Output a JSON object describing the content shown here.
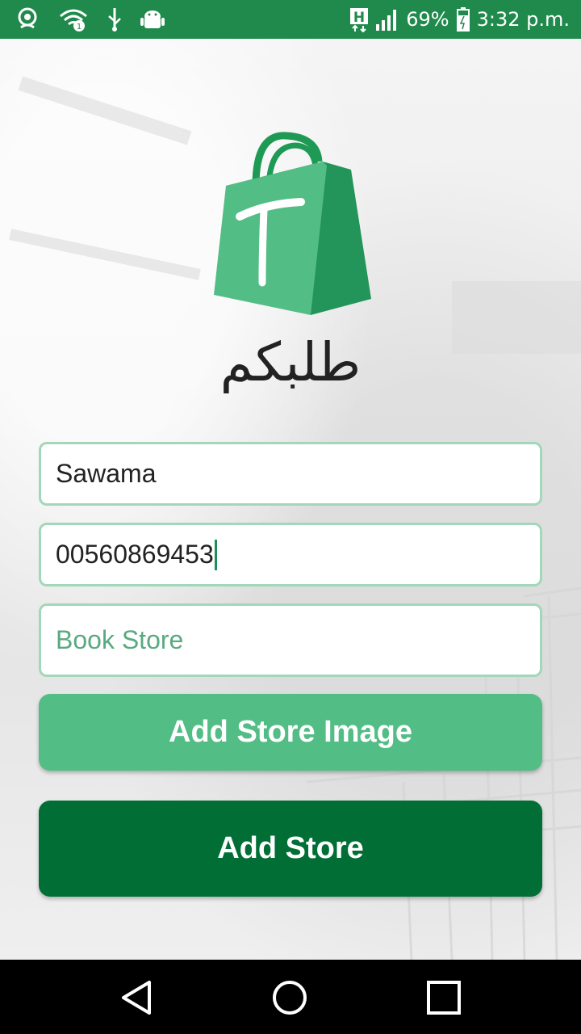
{
  "status_bar": {
    "battery_percent": "69%",
    "time": "3:32 p.m.",
    "network_badge": "H",
    "icons": [
      "location-icon",
      "wifi-icon",
      "usb-icon",
      "android-debug-icon",
      "network-type-icon",
      "signal-icon",
      "battery-icon"
    ]
  },
  "app": {
    "name": "طلبكم",
    "logo_letter": "T",
    "brand_color": "#53bd86",
    "brand_dark": "#016f35"
  },
  "form": {
    "store_name": "Sawama",
    "phone": "00560869453",
    "category_placeholder": "Book Store"
  },
  "buttons": {
    "add_image_label": "Add Store Image",
    "add_store_label": "Add Store"
  },
  "nav_bar": {
    "icons": [
      "back-icon",
      "home-icon",
      "recent-apps-icon"
    ]
  }
}
